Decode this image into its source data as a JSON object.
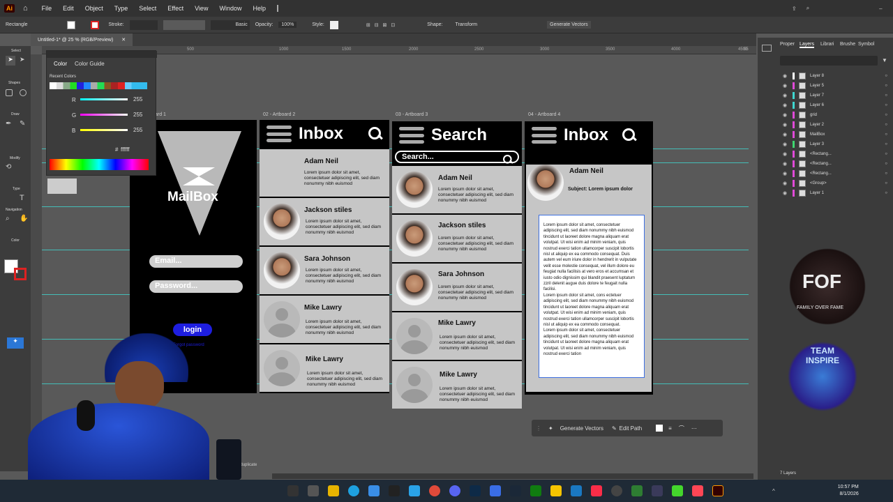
{
  "app_icon": "Ai",
  "menu": [
    "File",
    "Edit",
    "Object",
    "Type",
    "Select",
    "Effect",
    "View",
    "Window",
    "Help"
  ],
  "control_bar": {
    "object_type": "Rectangle",
    "stroke_label": "Stroke:",
    "basic": "Basic",
    "opacity_label": "Opacity:",
    "opacity_value": "100%",
    "style_label": "Style:",
    "shape_label": "Shape:",
    "transform": "Transform",
    "generate_vectors": "Generate Vectors"
  },
  "document_tab": "Untitled-1* @ 25 % (RGB/Preview)",
  "ruler_marks": [
    "500",
    "1000",
    "1500",
    "2000",
    "2500",
    "3000",
    "3500",
    "4000",
    "4500",
    "5000",
    "55"
  ],
  "tool_labels": {
    "select": "Select",
    "shapes": "Shapes",
    "draw": "Draw",
    "modify": "Modify",
    "type": "Type",
    "navigation": "Navigation",
    "color": "Color"
  },
  "color_panel": {
    "tab_color": "Color",
    "tab_guide": "Color Guide",
    "recent": "Recent Colors",
    "r": "R",
    "g": "G",
    "b": "B",
    "r_val": "255",
    "g_val": "255",
    "b_val": "255",
    "hex_prefix": "#",
    "hex": "ffffff"
  },
  "artboards": {
    "ab1": {
      "label": "ard 1",
      "title": "MailBox",
      "email": "Email...",
      "password": "Password...",
      "login": "login",
      "forgot": "Forgot password"
    },
    "ab2": {
      "label": "02 - Artboard 2",
      "header": "Inbox",
      "items": [
        {
          "name": "Adam Neil",
          "body": "Lorem ipsum dolor sit amet, consectetuer adipiscing elit, sed diam nonummy nibh euismod"
        },
        {
          "name": "Jackson stiles",
          "body": "Lorem ipsum dolor sit amet, consectetuer adipiscing elit, sed diam nonummy nibh euismod"
        },
        {
          "name": "Sara Johnson",
          "body": "Lorem ipsum dolor sit amet, consectetuer adipiscing elit, sed diam nonummy nibh euismod"
        },
        {
          "name": "Mike Lawry",
          "body": "Lorem ipsum dolor sit amet, consectetuer adipiscing elit, sed diam nonummy nibh euismod"
        },
        {
          "name": "Mike Lawry",
          "body": "Lorem ipsum dolor sit amet, consectetuer adipiscing elit, sed diam nonummy nibh euismod"
        }
      ]
    },
    "ab3": {
      "label": "03 - Artboard 3",
      "header": "Search",
      "search_placeholder": "Search...",
      "items": [
        {
          "name": "Adam Neil",
          "body": "Lorem ipsum dolor sit amet, consectetuer adipiscing elit, sed diam nonummy nibh euismod"
        },
        {
          "name": "Jackson stiles",
          "body": "Lorem ipsum dolor sit amet, consectetuer adipiscing elit, sed diam nonummy nibh euismod"
        },
        {
          "name": "Sara Johnson",
          "body": "Lorem ipsum dolor sit amet, consectetuer adipiscing elit, sed diam nonummy nibh euismod"
        },
        {
          "name": "Mike Lawry",
          "body": "Lorem ipsum dolor sit amet, consectetuer adipiscing elit, sed diam nonummy nibh euismod"
        },
        {
          "name": "Mike Lawry",
          "body": "Lorem ipsum dolor sit amet, consectetuer adipiscing elit, sed diam nonummy nibh euismod"
        }
      ]
    },
    "ab4": {
      "label": "04 - Artboard 4",
      "header": "Inbox",
      "sender": "Adam Neil",
      "subject": "Subject: Lorem ipsum dolor",
      "paragraph1": "Lorem ipsum dolor sit amet, consectetuer adipiscing elit, sed diam nonummy nibh euismod tincidunt ut laoreet dolore magna aliquam erat volutpat. Ut wisi enim ad minim veniam, quis nostrud exerci tation ullamcorper suscipit lobortis nisl ut aliquip ex ea commodo consequat. Duis autem vel eum iriure dolor in hendrerit in vulputate velit esse molestie consequat, vel illum dolore eu feugiat nulla facilisis at vero eros et accumsan et iusto odio dignissim qui blandit praesent luptatum zzril delenit augue duis dolore te feugait nulla facilisi.",
      "paragraph2": "Lorem ipsum dolor sit amet, cons ectetuer adipiscing elit, sed diam nonummy nibh euismod tincidunt ut laoreet dolore magna aliquam erat volutpat. Ut wisi enim ad minim veniam, quis nostrud exerci tation ullamcorper suscipit lobortis nisl ut aliquip ex ea commodo consequat.",
      "paragraph3": "Lorem ipsum dolor sit amet, consectetuer adipiscing elit, sed diam nonummy nibh euismod tincidunt ut laoreet dolore magna aliquam erat volutpat. Ut wisi enim ad minim veniam, quis nostrud exerci tation"
    }
  },
  "context_bar": {
    "generate": "Generate Vectors",
    "edit_path": "Edit Path"
  },
  "status_hint": "the object to duplicate",
  "right_panel": {
    "tabs": [
      "Proper",
      "Layers",
      "Librari",
      "Brushe",
      "Symbol"
    ],
    "layers": [
      {
        "name": "Layer 8",
        "color": "#ffffff"
      },
      {
        "name": "Layer 5",
        "color": "#e04ad8"
      },
      {
        "name": "Layer 7",
        "color": "#3fd7d0"
      },
      {
        "name": "Layer 6",
        "color": "#3fd7d0"
      },
      {
        "name": "grid",
        "color": "#e04ad8"
      },
      {
        "name": "Layer 2",
        "color": "#e04ad8"
      },
      {
        "name": "MailBox",
        "color": "#e04ad8"
      },
      {
        "name": "Layer 3",
        "color": "#3fd770"
      },
      {
        "name": "<Rectang...",
        "color": "#e04ad8"
      },
      {
        "name": "<Rectang...",
        "color": "#e04ad8"
      },
      {
        "name": "<Rectang...",
        "color": "#e04ad8"
      },
      {
        "name": "<Group>",
        "color": "#e04ad8"
      },
      {
        "name": "Layer 1",
        "color": "#e04ad8"
      }
    ],
    "count": "7 Layers"
  },
  "logos": {
    "fof_text": "FOF",
    "fof_sub": "FAMILY OVER FAME",
    "team": "TEAM INSPIRE"
  },
  "clock": {
    "time": "10:57 PM",
    "date": "8/1/2026"
  }
}
